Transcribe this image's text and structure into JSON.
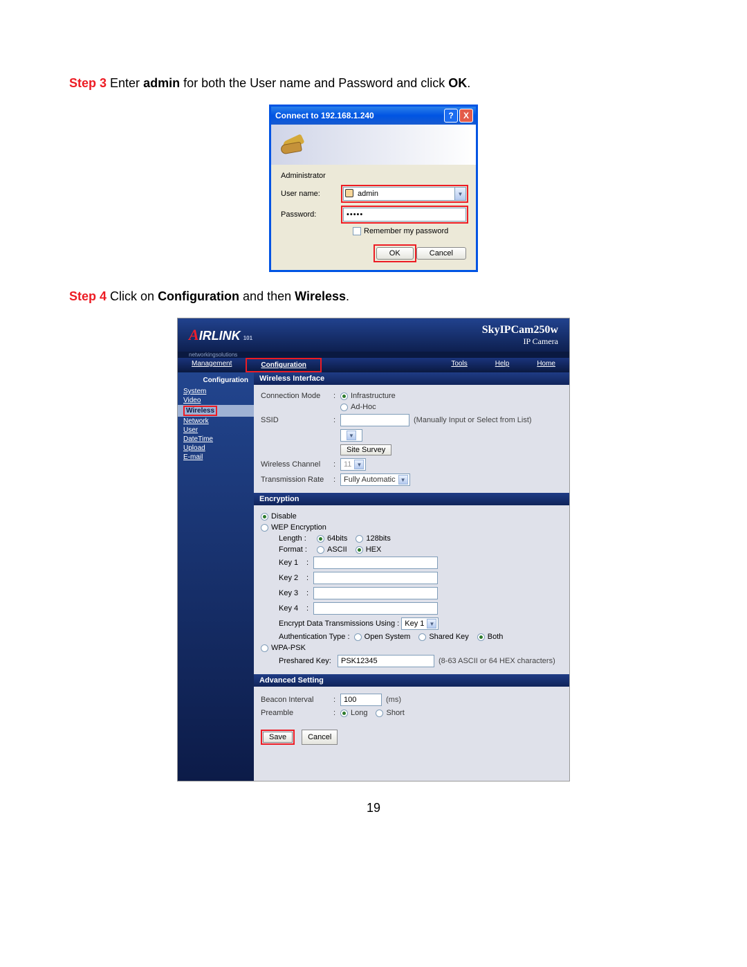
{
  "step3": {
    "label": "Step 3",
    "text_before": " Enter ",
    "admin": "admin",
    "text_mid": " for both the User name and Password and click ",
    "ok": "OK",
    "text_after": "."
  },
  "dialog": {
    "title": "Connect to 192.168.1.240",
    "server": "Administrator",
    "username_label": "User name:",
    "username_value": "admin",
    "password_label": "Password:",
    "password_value": "•••••",
    "remember_label": "Remember my password",
    "ok_label": "OK",
    "cancel_label": "Cancel"
  },
  "step4": {
    "label": "Step 4",
    "text_before": " Click on ",
    "configuration": "Configuration",
    "text_mid": " and then ",
    "wireless": "Wireless",
    "text_after": "."
  },
  "webui": {
    "brand": {
      "a": "A",
      "rest": "IRLINK",
      "sub": "101",
      "tagline": "networkingsolutions"
    },
    "camtitle1": "SkyIPCam250w",
    "camtitle2": "IP Camera",
    "nav": {
      "management": "Management",
      "configuration": "Configuration",
      "tools": "Tools",
      "help": "Help",
      "home": "Home"
    },
    "sidebar": {
      "header": "Configuration",
      "items": [
        "System",
        "Video",
        "Wireless",
        "Network",
        "User",
        "DateTime",
        "Upload",
        "E-mail"
      ]
    },
    "wireless_interface": {
      "header": "Wireless Interface",
      "conn_mode_label": "Connection Mode",
      "infrastructure": "Infrastructure",
      "adhoc": "Ad-Hoc",
      "ssid_label": "SSID",
      "ssid_value": "",
      "ssid_hint": "(Manually Input or Select from List)",
      "site_survey": "Site Survey",
      "channel_label": "Wireless Channel",
      "channel_value": "11",
      "rate_label": "Transmission Rate",
      "rate_value": "Fully Automatic"
    },
    "encryption": {
      "header": "Encryption",
      "disable": "Disable",
      "wep": "WEP Encryption",
      "length_label": "Length :",
      "len64": "64bits",
      "len128": "128bits",
      "format_label": "Format :",
      "ascii": "ASCII",
      "hex": "HEX",
      "key1": "Key 1",
      "key2": "Key 2",
      "key3": "Key 3",
      "key4": "Key 4",
      "encrypt_using_label": "Encrypt Data Transmissions Using :",
      "encrypt_using_value": "Key 1",
      "auth_label": "Authentication Type :",
      "auth_open": "Open System",
      "auth_shared": "Shared Key",
      "auth_both": "Both",
      "wpa": "WPA-PSK",
      "psk_label": "Preshared Key:",
      "psk_value": "PSK12345",
      "psk_hint": "(8-63 ASCII or 64 HEX characters)"
    },
    "advanced": {
      "header": "Advanced Setting",
      "beacon_label": "Beacon Interval",
      "beacon_value": "100",
      "beacon_unit": "(ms)",
      "preamble_label": "Preamble",
      "long": "Long",
      "short": "Short"
    },
    "save_label": "Save",
    "cancel_label": "Cancel"
  },
  "pagenum": "19"
}
